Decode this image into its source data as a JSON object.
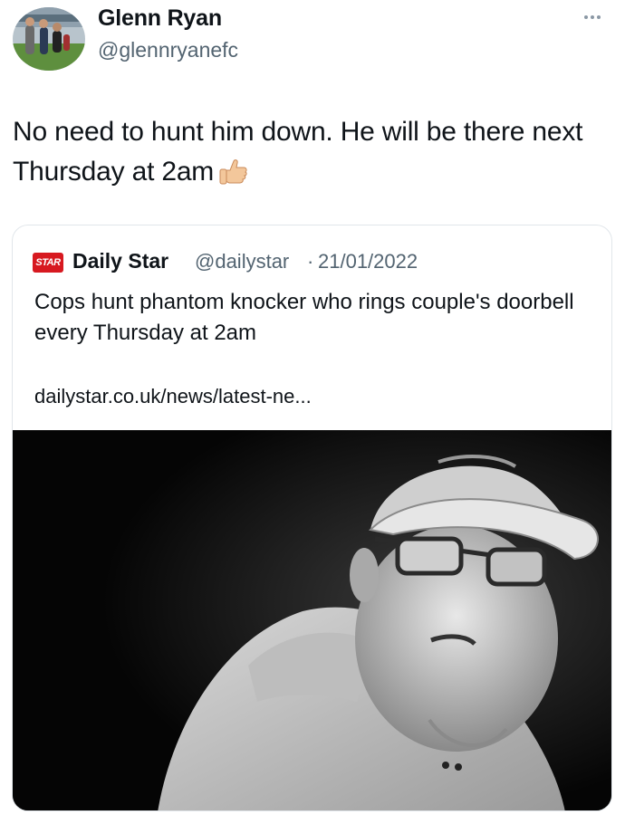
{
  "author": {
    "name": "Glenn Ryan",
    "handle": "@glennryanefc"
  },
  "tweet": {
    "text": "No need to hunt him down. He will be there next Thursday at 2am",
    "emoji": "thumbs-up"
  },
  "quoted": {
    "logo_text": "STAR",
    "name": "Daily Star",
    "handle": "@dailystar",
    "separator": "·",
    "date": "21/01/2022",
    "text": "Cops hunt phantom knocker who rings couple's doorbell every Thursday at 2am",
    "link": "dailystar.co.uk/news/latest-ne..."
  },
  "icons": {
    "more": "more-dots-icon",
    "thumb": "thumbs-up-emoji"
  }
}
